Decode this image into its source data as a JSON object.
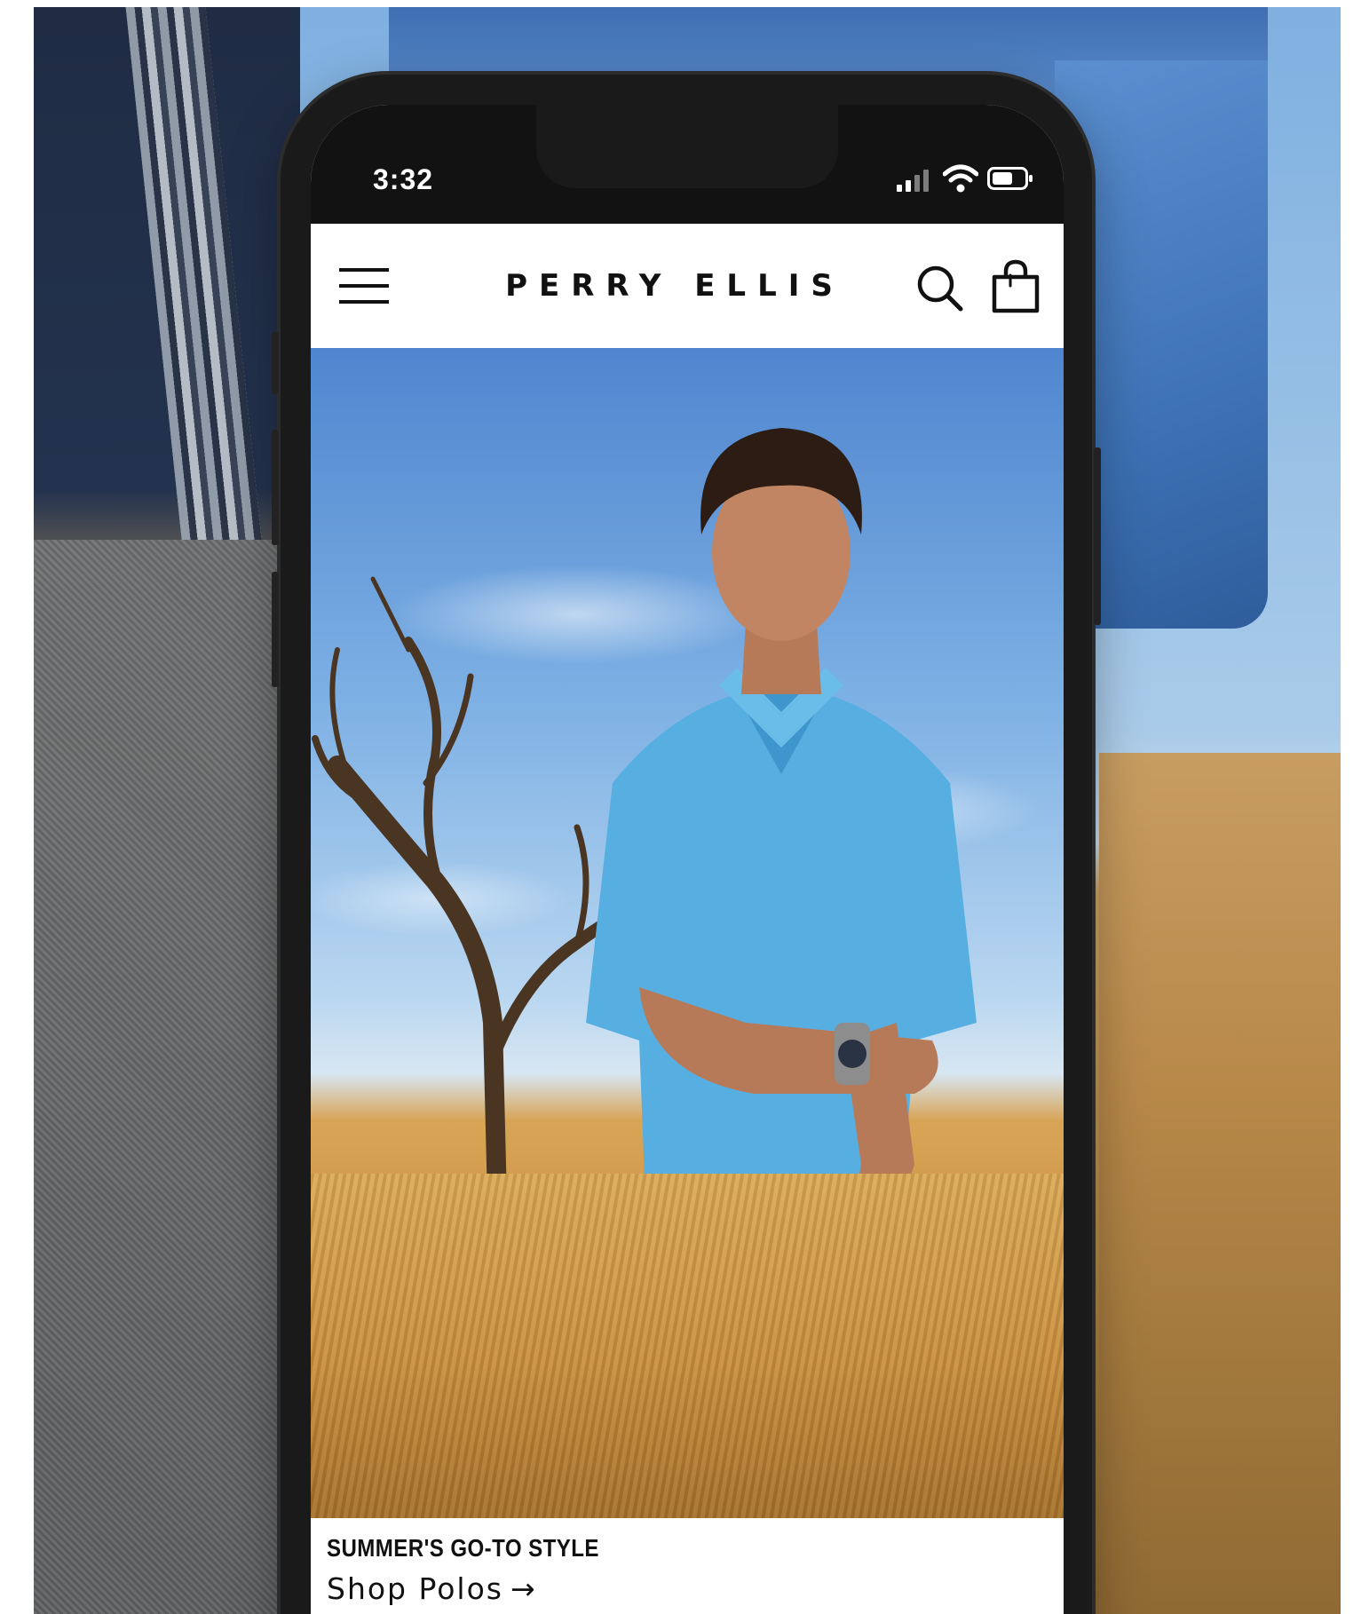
{
  "status_bar": {
    "time": "3:32"
  },
  "nav": {
    "brand": "PERRY ELLIS",
    "icons": [
      "menu-icon",
      "search-icon",
      "shopping-bag-icon"
    ]
  },
  "hero": {
    "title": "SUMMER'S GO-TO STYLE",
    "cta_label": "Shop Polos",
    "cta_arrow": "→"
  },
  "colors": {
    "status_bar_bg": "#121212",
    "nav_bg": "#ffffff",
    "text": "#111111",
    "phone_frame": "#1a1a1a"
  }
}
